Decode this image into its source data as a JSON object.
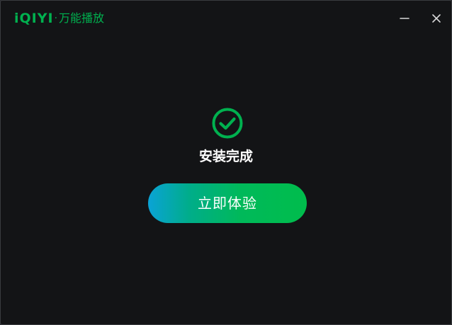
{
  "window": {
    "brand_mark": "iQIYI",
    "brand_separator": "·",
    "brand_product": "万能播放",
    "minimize_icon": "minimize-icon",
    "close_icon": "close-icon"
  },
  "main": {
    "status_icon": "check-circle-icon",
    "status_title": "安装完成",
    "cta_label": "立即体验"
  },
  "colors": {
    "background": "#131416",
    "brand_green": "#00b14f",
    "gradient_start": "#0aa3d6",
    "gradient_end": "#00bd4c",
    "text": "#ffffff"
  }
}
